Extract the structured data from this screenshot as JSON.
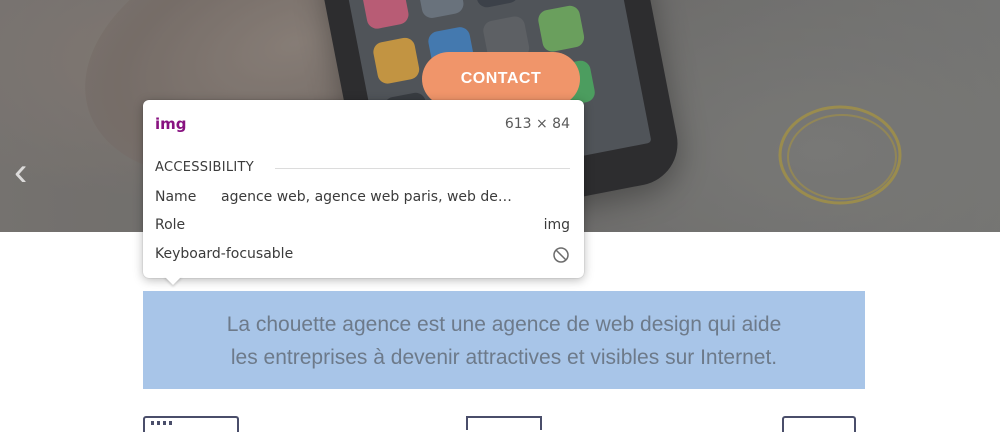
{
  "hero": {
    "contact_label": "CONTACT",
    "nav_prev_glyph": "‹"
  },
  "tooltip": {
    "tag": "img",
    "size": "613 × 84",
    "section_title": "ACCESSIBILITY",
    "rows": [
      {
        "label": "Name",
        "value": "agence web, agence web paris, web de…"
      },
      {
        "label": "Role",
        "value": "img"
      },
      {
        "label": "Keyboard-focusable",
        "value_icon": "not-allowed-icon"
      }
    ]
  },
  "main": {
    "tagline_line1": "La chouette agence est une agence de web design qui aide",
    "tagline_line2": "les entreprises à devenir attractives et visibles sur Internet."
  },
  "colors": {
    "accent_button": "#f0956a",
    "highlight": "#a8c5e8",
    "tag_name": "#881280"
  }
}
